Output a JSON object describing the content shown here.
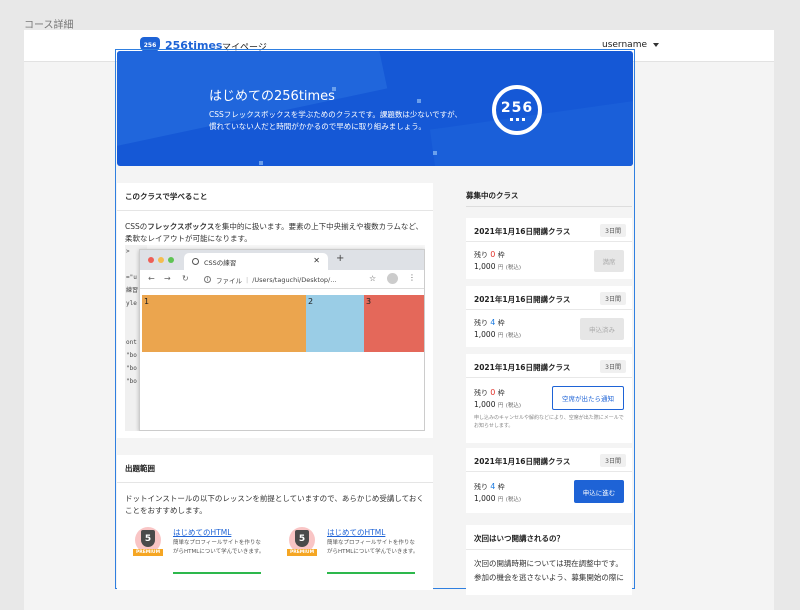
{
  "page_label": "コース詳細",
  "header": {
    "logo_text": "256times",
    "logo_badge": "256",
    "nav_mypage": "マイページ",
    "username": "username"
  },
  "hero": {
    "title": "はじめての256times",
    "description": "CSSフレックスボックスを学ぶためのクラスです。課題数は少ないですが、慣れていない人だと時間がかかるので早めに取り組みましょう。",
    "logo_number": "256"
  },
  "learn": {
    "title": "このクラスで学べること",
    "body_prefix": "CSSの",
    "body_bold": "フレックスボックス",
    "body_suffix": "を集中的に扱います。要素の上下中央揃えや複数カラムなど、柔軟なレイアウトが可能になります。",
    "browser": {
      "tab_title": "CSSの練習",
      "url_label": "ファイル",
      "url_path": "/Users/taguchi/Desktop/...",
      "boxes": [
        "1",
        "2",
        "3"
      ],
      "box_colors": [
        "#eba54e",
        "#9acde6",
        "#e4685a"
      ],
      "code_lines": [
        ">",
        "",
        "=\"u",
        "練習",
        "yle",
        "",
        "",
        "ont",
        "\"bo",
        "\"bo",
        "\"bo"
      ]
    }
  },
  "classes": {
    "heading": "募集中のクラス",
    "items": [
      {
        "title": "2021年1月16日開講クラス",
        "duration": "3日間",
        "remain_label": "残り",
        "remain_count": "0",
        "remain_unit": "枠",
        "price": "1,000",
        "price_unit": "円",
        "tax_note": "(税込)",
        "button": "満席",
        "button_style": "disabled"
      },
      {
        "title": "2021年1月16日開講クラス",
        "duration": "3日間",
        "remain_label": "残り",
        "remain_count": "4",
        "remain_unit": "枠",
        "price": "1,000",
        "price_unit": "円",
        "tax_note": "(税込)",
        "button": "申込済み",
        "button_style": "disabled"
      },
      {
        "title": "2021年1月16日開講クラス",
        "duration": "3日間",
        "remain_label": "残り",
        "remain_count": "0",
        "remain_unit": "枠",
        "price": "1,000",
        "price_unit": "円",
        "tax_note": "(税込)",
        "button": "空席が出たら通知",
        "button_style": "outline",
        "note": "申し込みのキャンセルや解約などにより、空席が出た際にメールでお知らせします。"
      },
      {
        "title": "2021年1月16日開講クラス",
        "duration": "3日間",
        "remain_label": "残り",
        "remain_count": "4",
        "remain_unit": "枠",
        "price": "1,000",
        "price_unit": "円",
        "tax_note": "(税込)",
        "button": "申込に進む",
        "button_style": "primary"
      }
    ]
  },
  "scope": {
    "title": "出題範囲",
    "body": "ドットインストールの以下のレッスンを前提としていますので、あらかじめ受講しておくことをおすすめします。",
    "lessons": [
      {
        "title": "はじめてのHTML",
        "desc": "簡単なプロフィールサイトを作りながらHTMLについて学んでいきます。",
        "badge": "5",
        "premium": "PREMIUM"
      },
      {
        "title": "はじめてのHTML",
        "desc": "簡単なプロフィールサイトを作りながらHTMLについて学んでいきます。",
        "badge": "5",
        "premium": "PREMIUM"
      }
    ]
  },
  "next": {
    "title": "次回はいつ開講されるの？",
    "body": "次回の開講時期については現在調整中です。参加の機会を逃さないよう、募集開始の際に"
  },
  "colors": {
    "brand": "#1e63d6",
    "hero_bg": "#1558d6",
    "remain_zero": "#e0332b",
    "remain_available": "#1e7be0"
  }
}
